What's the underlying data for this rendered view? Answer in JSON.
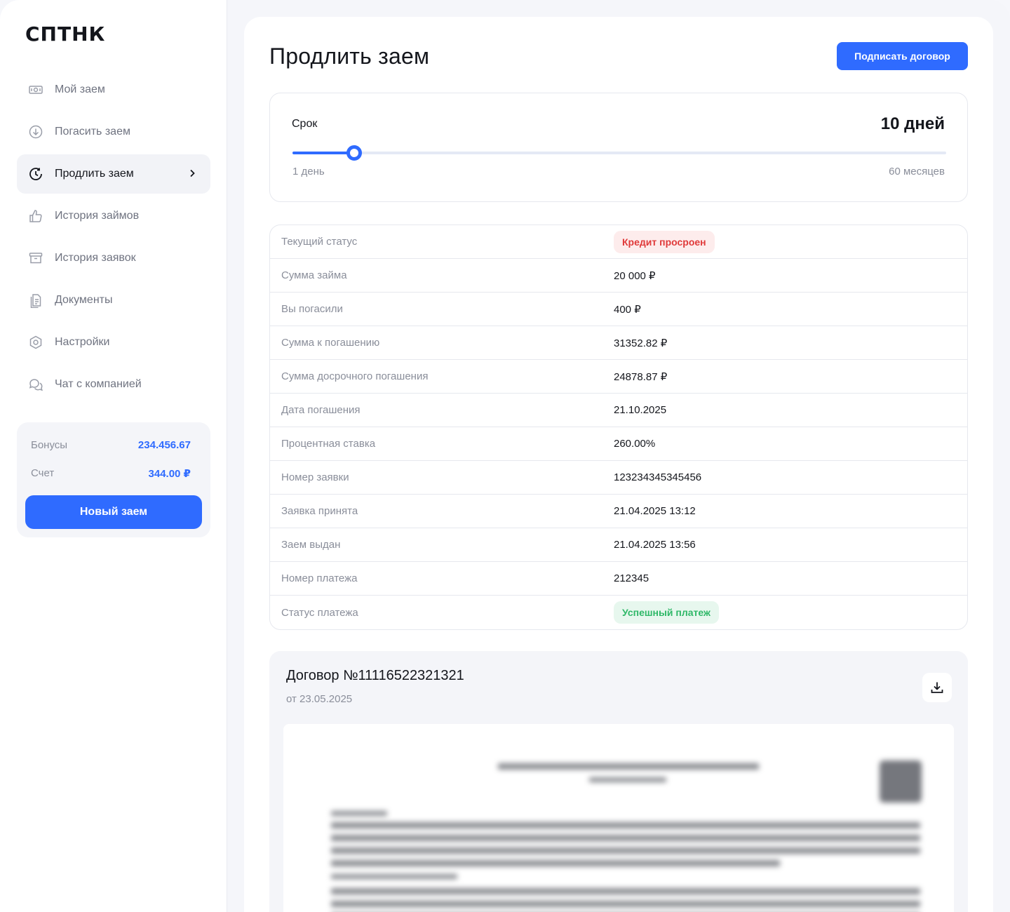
{
  "brand": {
    "logo_text": "СПТНК"
  },
  "sidebar": {
    "items": [
      {
        "label": "Мой заем",
        "icon": "banknote-icon",
        "active": false
      },
      {
        "label": "Погасить заем",
        "icon": "arrow-down-circle-icon",
        "active": false
      },
      {
        "label": "Продлить заем",
        "icon": "clock-refresh-icon",
        "active": true
      },
      {
        "label": "История займов",
        "icon": "thumbs-up-icon",
        "active": false
      },
      {
        "label": "История заявок",
        "icon": "archive-icon",
        "active": false
      },
      {
        "label": "Документы",
        "icon": "documents-icon",
        "active": false
      },
      {
        "label": "Настройки",
        "icon": "hexagon-settings-icon",
        "active": false
      },
      {
        "label": "Чат с компанией",
        "icon": "chat-icon",
        "active": false
      }
    ],
    "balance": {
      "bonuses_label": "Бонусы",
      "bonuses_value": "234.456.67",
      "account_label": "Счет",
      "account_value": "344.00 ₽",
      "new_loan_label": "Новый заем"
    }
  },
  "main": {
    "title": "Продлить заем",
    "sign_button": "Подписать договор",
    "term": {
      "label": "Срок",
      "value": "10 дней",
      "min_label": "1 день",
      "max_label": "60 месяцев",
      "slider_fraction": 0.094
    },
    "info_rows": [
      {
        "key": "Текущий статус",
        "value": "Кредит просроен",
        "badge": "red"
      },
      {
        "key": "Сумма займа",
        "value": "20 000 ₽"
      },
      {
        "key": "Вы погасили",
        "value": "400 ₽"
      },
      {
        "key": "Сумма к погашению",
        "value": "31352.82 ₽"
      },
      {
        "key": "Сумма досрочного погашения",
        "value": "24878.87 ₽"
      },
      {
        "key": "Дата погашения",
        "value": "21.10.2025"
      },
      {
        "key": "Процентная ставка",
        "value": "260.00%"
      },
      {
        "key": "Номер заявки",
        "value": "123234345345456"
      },
      {
        "key": "Заявка принята",
        "value": "21.04.2025 13:12"
      },
      {
        "key": "Заем выдан",
        "value": "21.04.2025 13:56"
      },
      {
        "key": "Номер платежа",
        "value": "212345"
      },
      {
        "key": "Статус платежа",
        "value": "Успешный платеж",
        "badge": "green"
      }
    ],
    "contract": {
      "title": "Договор №11116522321321",
      "date": "от 23.05.2025"
    }
  },
  "colors": {
    "accent": "#2f6bff",
    "danger": "#e03a3a",
    "success": "#2fb868"
  }
}
